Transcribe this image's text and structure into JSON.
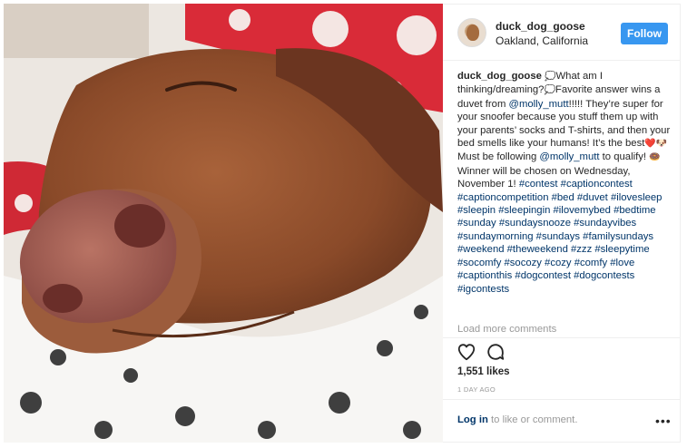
{
  "post": {
    "photo_alt": "sleeping dog",
    "author": "duck_dog_goose",
    "location": "Oakland, California",
    "follow_label": "Follow",
    "caption": {
      "user": "duck_dog_goose",
      "text_1": "What am I thinking/dreaming?",
      "text_2": "Favorite answer wins a duvet from",
      "mention_1": "@molly_mutt",
      "text_3": "!!!!! They’re super for your snoofer because you stuff them up with your parents’ socks and T-shirts, and then your bed smells like your humans! It’s the best",
      "text_4": "Must be following",
      "mention_2": "@molly_mutt",
      "text_5": " to qualify!",
      "text_6": "Winner will be chosen on Wednesday, November 1!",
      "hashtags": "#contest #captioncontest #captioncompetition #bed #duvet #ilovesleep #sleepin #sleepingin #ilovemybed #bedtime #sunday #sundaysnooze #sundayvibes #sundaymorning #sundays #familysundays #weekend #theweekend #zzz #sleepytime #socomfy #socozy #cozy #comfy #love #captionthis #dogcontest #dogcontests #igcontests"
    },
    "load_more": "Load more comments",
    "likes": "1,551 likes",
    "time_ago": "1 DAY AGO",
    "login_link": "Log in",
    "login_text": " to like or comment.",
    "more_glyph": "•••",
    "icons": {
      "heart": "heart-icon",
      "comment": "comment-icon",
      "more": "more-options-icon"
    },
    "colors": {
      "follow_button": "#3897f0",
      "link": "#003569",
      "muted": "#999999"
    }
  }
}
